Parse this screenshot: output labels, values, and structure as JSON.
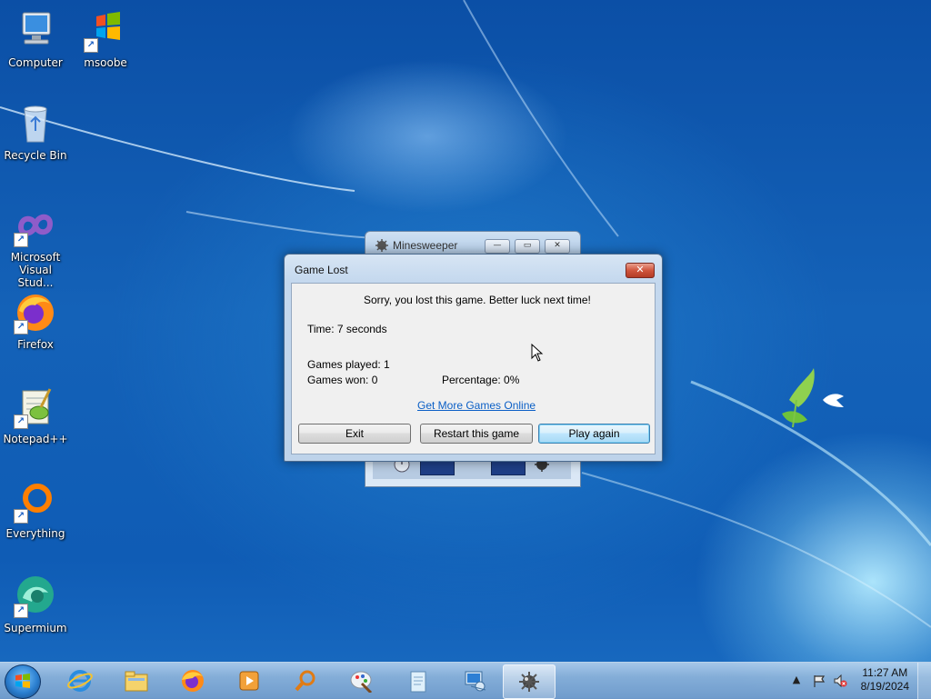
{
  "desktop": {
    "icons": [
      {
        "label": "Computer",
        "icon": "computer-icon"
      },
      {
        "label": "msoobe",
        "icon": "windows-logo-icon"
      },
      {
        "label": "Recycle Bin",
        "icon": "recycle-bin-icon"
      },
      {
        "label": "Microsoft Visual Stud...",
        "icon": "visual-studio-icon"
      },
      {
        "label": "Firefox",
        "icon": "firefox-icon"
      },
      {
        "label": "Notepad++",
        "icon": "notepadpp-icon"
      },
      {
        "label": "Everything",
        "icon": "everything-search-icon"
      },
      {
        "label": "Supermium",
        "icon": "supermium-icon"
      }
    ]
  },
  "minesweeper": {
    "title": "Minesweeper"
  },
  "dialog": {
    "title": "Game Lost",
    "message": "Sorry, you lost this game. Better luck next time!",
    "time": "Time: 7 seconds",
    "games_played": "Games played: 1",
    "games_won": "Games won: 0",
    "percentage": "Percentage: 0%",
    "link": "Get More Games Online",
    "buttons": {
      "exit": "Exit",
      "restart": "Restart this game",
      "play_again": "Play again"
    }
  },
  "taskbar": {
    "items": [
      {
        "icon": "internet-explorer-icon"
      },
      {
        "icon": "file-explorer-icon"
      },
      {
        "icon": "firefox-icon"
      },
      {
        "icon": "media-player-icon"
      },
      {
        "icon": "search-magnifier-icon"
      },
      {
        "icon": "paint-icon"
      },
      {
        "icon": "notepad-icon"
      },
      {
        "icon": "network-computer-icon"
      },
      {
        "icon": "minesweeper-icon",
        "active": true
      }
    ],
    "clock_time": "11:27 AM",
    "clock_date": "8/19/2024"
  },
  "colors": {
    "desktop_blue": "#1462b8",
    "link": "#0b5fc6",
    "close_red": "#d0553d"
  }
}
